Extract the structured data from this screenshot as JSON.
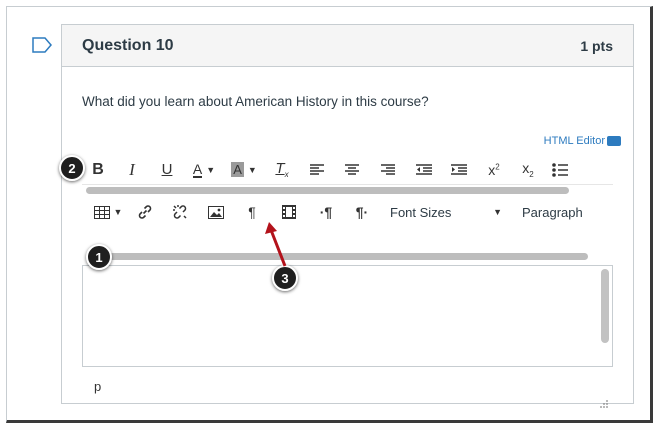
{
  "question": {
    "title": "Question 10",
    "points": "1 pts",
    "text": "What did you learn about American History in this course?"
  },
  "editor": {
    "html_editor_label": "HTML Editor",
    "toolbar1": [
      {
        "name": "bold-icon",
        "glyph": "B"
      },
      {
        "name": "italic-icon",
        "glyph": "I"
      },
      {
        "name": "underline-icon",
        "glyph": "U"
      },
      {
        "name": "text-color-icon",
        "glyph": "A"
      },
      {
        "name": "background-color-icon",
        "glyph": "A"
      },
      {
        "name": "clear-formatting-icon",
        "glyph": "T"
      },
      {
        "name": "align-left-icon",
        "glyph": "≡"
      },
      {
        "name": "align-center-icon",
        "glyph": "≡"
      },
      {
        "name": "align-right-icon",
        "glyph": "≡"
      },
      {
        "name": "outdent-icon",
        "glyph": "⇤"
      },
      {
        "name": "indent-icon",
        "glyph": "⇥"
      },
      {
        "name": "superscript-icon",
        "glyph": "x²"
      },
      {
        "name": "subscript-icon",
        "glyph": "x₂"
      },
      {
        "name": "bullet-list-icon",
        "glyph": "☰"
      }
    ],
    "font_sizes_label": "Font Sizes",
    "paragraph_label": "Paragraph",
    "status_path": "p"
  },
  "callouts": {
    "one": "1",
    "two": "2",
    "three": "3"
  },
  "colors": {
    "link": "#2d7bbf",
    "arrow": "#b3121b",
    "callout_bg": "#1f1f1f"
  }
}
